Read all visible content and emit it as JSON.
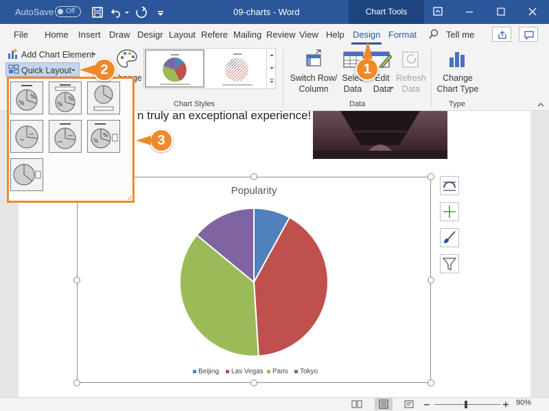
{
  "titlebar": {
    "autosave_label": "AutoSave",
    "autosave_state": "Off",
    "document_title": "09-charts - Word",
    "context_tab": "Chart Tools"
  },
  "tabs": [
    {
      "label": "File"
    },
    {
      "label": "Home"
    },
    {
      "label": "Insert"
    },
    {
      "label": "Draw"
    },
    {
      "label": "Desigr"
    },
    {
      "label": "Layout"
    },
    {
      "label": "Refere"
    },
    {
      "label": "Mailing"
    },
    {
      "label": "Review"
    },
    {
      "label": "View"
    },
    {
      "label": "Help"
    },
    {
      "label": "Design"
    },
    {
      "label": "Format"
    }
  ],
  "tell_me": "Tell me",
  "ribbon": {
    "add_chart_element": "Add Chart Element",
    "quick_layout": "Quick Layout",
    "change_colors_partial": "hange",
    "chart_styles_label": "Chart Styles",
    "switch_row_col_1": "Switch Row/",
    "switch_row_col_2": "Column",
    "select_data_1": "Selec",
    "select_data_2": "Data",
    "edit_data_1": "Edit",
    "edit_data_2": "Data",
    "refresh_data_1": "Refresh",
    "refresh_data_2": "Data",
    "data_label": "Data",
    "change_chart_type_1": "Change",
    "change_chart_type_2": "Chart Type",
    "type_label": "Type"
  },
  "document": {
    "text": "n truly an exceptional experience!"
  },
  "chart_data": {
    "type": "pie",
    "title": "Popularity",
    "categories": [
      "Beijing",
      "Las Vegas",
      "Paris",
      "Tokyo"
    ],
    "values": [
      8,
      41,
      37,
      14
    ],
    "colors": [
      "#4f81bd",
      "#c0504d",
      "#9bbb59",
      "#8064a2"
    ],
    "legend_position": "bottom"
  },
  "callouts": [
    "1",
    "2",
    "3"
  ],
  "status": {
    "zoom": "90%"
  },
  "colors": {
    "accent": "#2b579a",
    "callout": "#ee8a2b"
  }
}
